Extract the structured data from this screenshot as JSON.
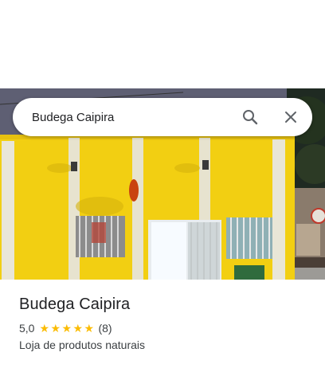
{
  "search": {
    "query": "Budega Caipira",
    "search_icon": "search-icon",
    "close_icon": "close-icon"
  },
  "place": {
    "name": "Budega Caipira",
    "rating": "5,0",
    "rating_value": 5.0,
    "stars_filled": 5,
    "review_count": "(8)",
    "category": "Loja de produtos naturais"
  },
  "colors": {
    "star": "#fbbc04",
    "facade_yellow": "#f2cf12",
    "text_primary": "#202124",
    "text_secondary": "#3c4043"
  }
}
